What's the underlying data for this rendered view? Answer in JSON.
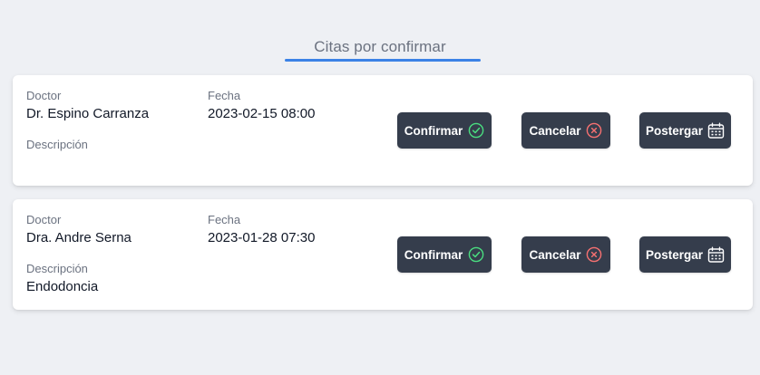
{
  "header": {
    "title": "Citas por confirmar"
  },
  "labels": {
    "doctor": "Doctor",
    "fecha": "Fecha",
    "descripcion": "Descripción"
  },
  "buttons": {
    "confirm_label": "Confirmar",
    "cancel_label": "Cancelar",
    "postpone_label": "Postergar"
  },
  "icons": {
    "confirm": "check-circle-icon",
    "cancel": "x-circle-icon",
    "postpone": "calendar-icon"
  },
  "colors": {
    "accent": "#3b82e6",
    "button_bg": "#353d4c",
    "confirm_icon": "#4ade80",
    "cancel_icon": "#f87171",
    "page_bg": "#eef0f4"
  },
  "appointments": [
    {
      "doctor": "Dr. Espino Carranza",
      "fecha": "2023-02-15 08:00",
      "descripcion": ""
    },
    {
      "doctor": "Dra. Andre Serna",
      "fecha": "2023-01-28 07:30",
      "descripcion": "Endodoncia"
    }
  ]
}
